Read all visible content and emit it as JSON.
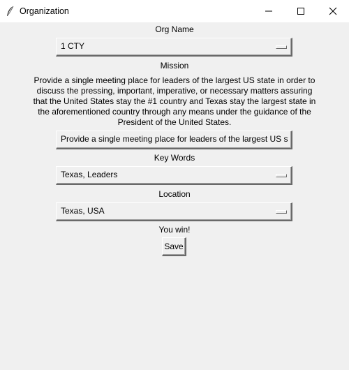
{
  "window": {
    "title": "Organization",
    "app_icon": "feather-icon",
    "controls": {
      "minimize_icon": "minimize-icon",
      "maximize_icon": "maximize-icon",
      "close_icon": "close-icon"
    }
  },
  "form": {
    "org_name_label": "Org Name",
    "org_name_value": "1 CTY",
    "mission_label": "Mission",
    "mission_lines": [
      "Provide a single meeting place for leaders of the largest US state in order to",
      "discuss the pressing, important, imperative, or necessary matters assuring",
      "that the United States stay the #1 country and Texas stay the largest state in",
      "the aforementioned country through any means under the guidance of the",
      "President of the United States."
    ],
    "mission_entry_value": "Provide a single meeting place for leaders of the largest US state",
    "keywords_label": "Key Words",
    "keywords_value": "Texas, Leaders",
    "location_label": "Location",
    "location_value": "Texas, USA",
    "status_text": "You win!",
    "save_label": "Save"
  }
}
